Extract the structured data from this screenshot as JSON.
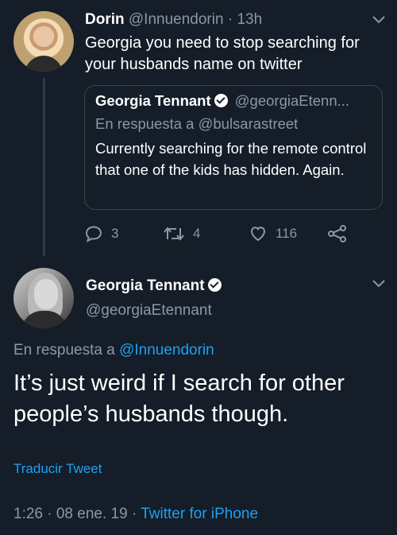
{
  "colors": {
    "background": "#151d28",
    "text": "#ffffff",
    "muted": "#8899a6",
    "link": "#1da1f2",
    "border": "#38444d"
  },
  "tweet1": {
    "display_name": "Dorin",
    "handle": "@Innuendorin",
    "separator": "·",
    "time": "13h",
    "text": "Georgia you need to stop searching for your husbands name on twitter",
    "quoted": {
      "display_name": "Georgia Tennant",
      "handle": "@georgiaEtenn...",
      "reply_prefix": "En respuesta a",
      "reply_handle": "@bulsarastreet",
      "text": "Currently searching for the remote control that one of the kids has hidden. Again."
    },
    "actions": {
      "replies": "3",
      "retweets": "4",
      "likes": "116",
      "reply_icon": "reply-icon",
      "retweet_icon": "retweet-icon",
      "like_icon": "heart-icon",
      "share_icon": "share-icon"
    }
  },
  "tweet2": {
    "display_name": "Georgia Tennant",
    "handle": "@georgiaEtennant",
    "reply_prefix": "En respuesta a",
    "reply_handle": "@Innuendorin",
    "text": "It’s just weird if I search for other people’s husbands though.",
    "translate_label": "Traducir Tweet",
    "timestamp": "1:26 · 08 ene. 19",
    "meta_separator": "·",
    "source": "Twitter for iPhone"
  }
}
